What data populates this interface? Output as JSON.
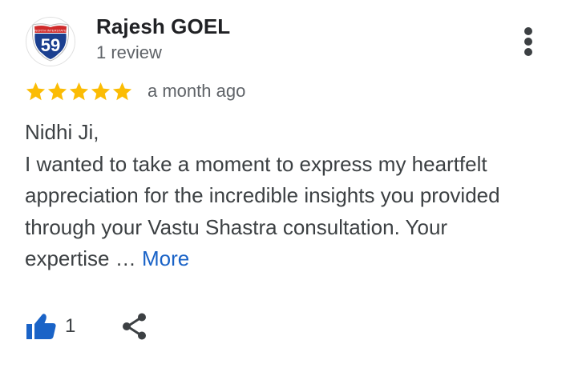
{
  "reviewer": {
    "name": "Rajesh GOEL",
    "review_count": "1 review",
    "avatar": {
      "icon": "interstate-shield-icon",
      "number": "59",
      "banner_text": "NORTH INTERSTATE",
      "colors": {
        "blue": "#1b3f8f",
        "red": "#cf2a2a",
        "white": "#ffffff"
      }
    }
  },
  "rating": {
    "stars": 5,
    "max_stars": 5,
    "star_color": "#fbbc04",
    "date": "a month ago"
  },
  "review": {
    "lines": [
      "Nidhi Ji,",
      "I wanted to take a moment to express my heartfelt",
      "appreciation for the incredible insights you provided",
      "through your Vastu Shastra consultation. Your",
      "expertise …"
    ],
    "more_label": "More"
  },
  "actions": {
    "like_count": "1",
    "like_icon": "thumbs-up-icon",
    "share_icon": "share-icon",
    "accent_color": "#1a63c7"
  },
  "menu": {
    "icon": "more-vertical-icon"
  }
}
